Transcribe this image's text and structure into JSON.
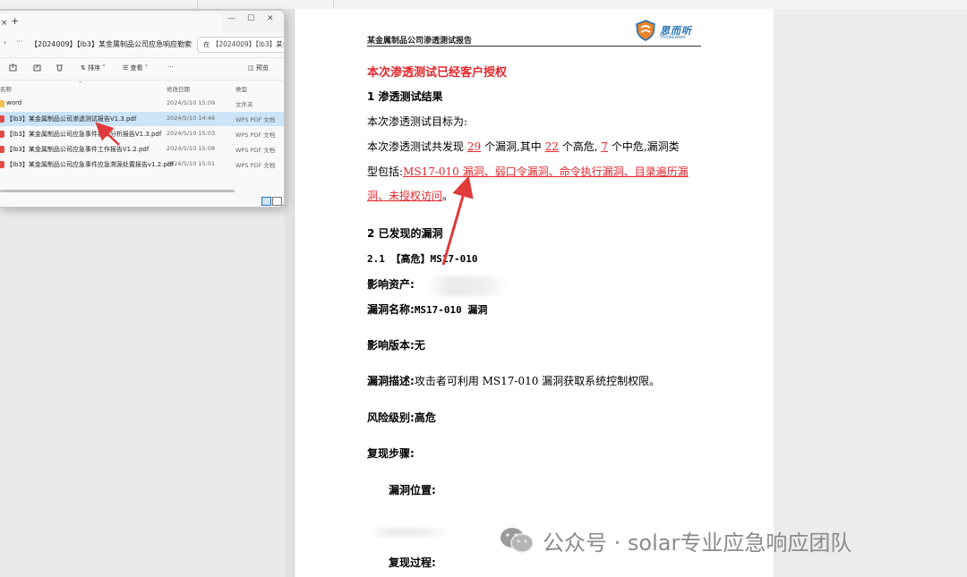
{
  "explorer": {
    "new_tab": "+",
    "tab_close": "×",
    "window_controls": {
      "minimize": "—",
      "maximize": "☐",
      "close": "✕"
    },
    "nav_back": "›",
    "nav_more": "···",
    "breadcrumb": "【2024009】【lb3】某金属制品公司应急响应勒索",
    "search_placeholder": "在 【2024009】【lb3】某金",
    "toolbar": {
      "sort_label": "排序",
      "view_label": "查看",
      "more": "···",
      "preview_label": "预览"
    },
    "columns": {
      "name": "名称",
      "date": "修改日期",
      "type": "类型"
    },
    "files": [
      {
        "name": "word",
        "date": "2024/5/10 15:09",
        "type": "文件夹",
        "icon": "folder-icon",
        "selected": false
      },
      {
        "name": "【lb3】某金属制品公司渗透测试报告V1.3.pdf",
        "date": "2024/5/10 14:46",
        "type": "WPS PDF 文档",
        "icon": "pdf-icon",
        "selected": true
      },
      {
        "name": "【lb3】某金属制品公司应急事件病毒分析报告V1.3.pdf",
        "date": "2024/5/10 15:03",
        "type": "WPS PDF 文档",
        "icon": "pdf-icon",
        "selected": false
      },
      {
        "name": "【lb3】某金属制品公司应急事件工作报告V1.2.pdf",
        "date": "2024/5/10 15:08",
        "type": "WPS PDF 文档",
        "icon": "pdf-icon",
        "selected": false
      },
      {
        "name": "【lb3】某金属制品公司应急事件应急溯源处置报告v1.2.pdf",
        "date": "2024/5/10 15:01",
        "type": "WPS PDF 文档",
        "icon": "pdf-icon",
        "selected": false
      }
    ]
  },
  "document": {
    "header_title": "某金属制品公司渗透测试报告",
    "logo_brand": "思而听",
    "logo_sub": "ThinkListen",
    "authorization_note": "本次渗透测试已经客户授权",
    "section1_heading": "1 渗透测试结果",
    "target_line": "本次渗透测试目标为:",
    "summary": {
      "p1": "本次渗透测试共发现",
      "total": "29",
      "p2": "个漏洞,其中",
      "high": "22",
      "p3": "个高危,",
      "medium": "7",
      "p4": "个中危,漏洞类",
      "p5": "型包括:",
      "types_line1": "MS17-010 漏洞、弱口令漏洞、命令执行漏洞、目录遍历漏",
      "types_line2": "洞、未授权访问",
      "end": "。"
    },
    "section2_heading": "2 已发现的漏洞",
    "vuln_heading": "2.1 【高危】MS17-010",
    "asset_label": "影响资产:",
    "name_label": "漏洞名称:",
    "name_value": "MS17-010 漏洞",
    "version_label": "影响版本:",
    "version_value": "无",
    "desc_label": "漏洞描述:",
    "desc_value": "攻击者可利用 MS17-010 漏洞获取系统控制权限。",
    "risk_label": "风险级别:",
    "risk_value": "高危",
    "steps_label": "复现步骤:",
    "location_label": "漏洞位置:",
    "process_label": "复现过程:"
  },
  "watermark": {
    "text": "公众号 · solar专业应急响应团队",
    "icon": "wechat-icon"
  },
  "colors": {
    "accent_red": "#e5252a",
    "selection": "#cce4f7",
    "brand_blue": "#1e6fb5",
    "arrow": "#e03a3a"
  }
}
